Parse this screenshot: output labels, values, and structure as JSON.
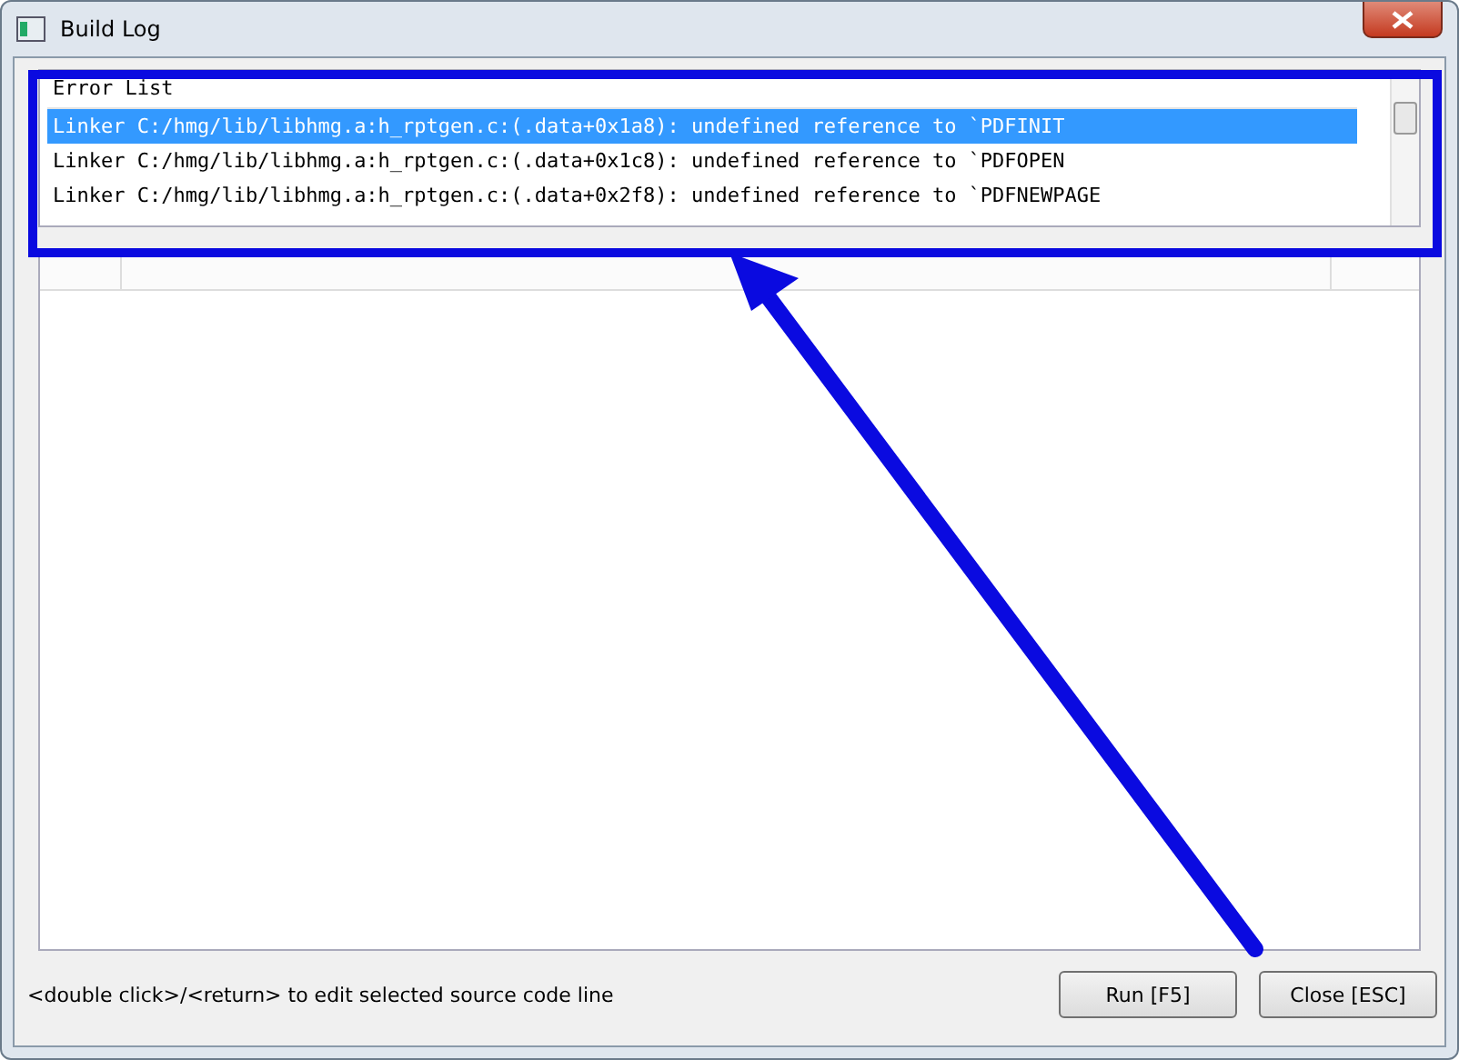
{
  "window": {
    "title": "Build Log"
  },
  "error_list": {
    "header": "Error List",
    "rows": [
      {
        "text": "Linker C:/hmg/lib/libhmg.a:h_rptgen.c:(.data+0x1a8): undefined reference to `PDFINIT",
        "selected": true
      },
      {
        "text": "Linker C:/hmg/lib/libhmg.a:h_rptgen.c:(.data+0x1c8): undefined reference to `PDFOPEN",
        "selected": false
      },
      {
        "text": "Linker C:/hmg/lib/libhmg.a:h_rptgen.c:(.data+0x2f8): undefined reference to `PDFNEWPAGE",
        "selected": false
      }
    ]
  },
  "hint": "<double click>/<return> to edit selected source code line",
  "buttons": [
    "Run [F5]",
    "Close [ESC]"
  ]
}
